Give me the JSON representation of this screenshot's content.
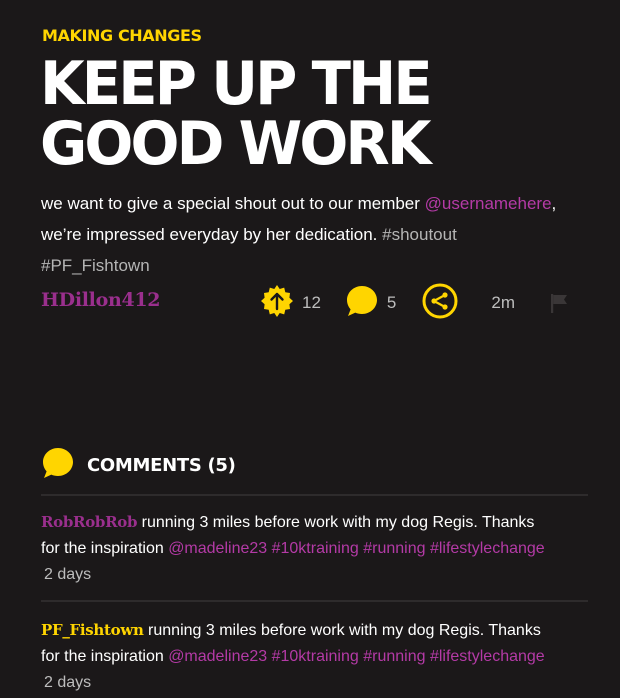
{
  "eyebrow": "MAKING CHANGES",
  "headline": {
    "line1": "KEEP UP THE",
    "line2": "GOOD WORK"
  },
  "post": {
    "text_1": "we want to give a special shout out to our member ",
    "mention": "@usernamehere",
    "text_2": ",",
    "text_3": "we’re impressed everyday by her dedication. ",
    "tag_1": "#shoutout",
    "tag_2": "#PF_Fishtown",
    "author": "HDillon412",
    "upvotes": "12",
    "comments_count": "5",
    "time": "2m"
  },
  "icons": {
    "upvote": "upvote-badge-icon",
    "comment": "speech-bubble-icon",
    "share": "share-icon",
    "flag": "flag-icon"
  },
  "colors": {
    "accent_yellow": "#ffd500",
    "mention_purple": "#b43aa6",
    "username_purple": "#9a2f8d",
    "background": "#1b1819"
  },
  "comments_section": {
    "title": "COMMENTS (5)"
  },
  "comments": [
    {
      "user": "RobRobRob",
      "user_color": "#9a2f8d",
      "text_1": "running 3 miles before work with my dog Regis. Thanks",
      "text_2": "for the inspiration ",
      "mentions": "@madeline23 #10ktraining #running #lifestylechange",
      "time": "2 days"
    },
    {
      "user": "PF_Fishtown",
      "user_color": "#ffd500",
      "text_1": "running 3 miles before work with my dog Regis. Thanks",
      "text_2": "for the inspiration ",
      "mentions": "@madeline23 #10ktraining #running #lifestylechange",
      "time": "2 days"
    }
  ]
}
